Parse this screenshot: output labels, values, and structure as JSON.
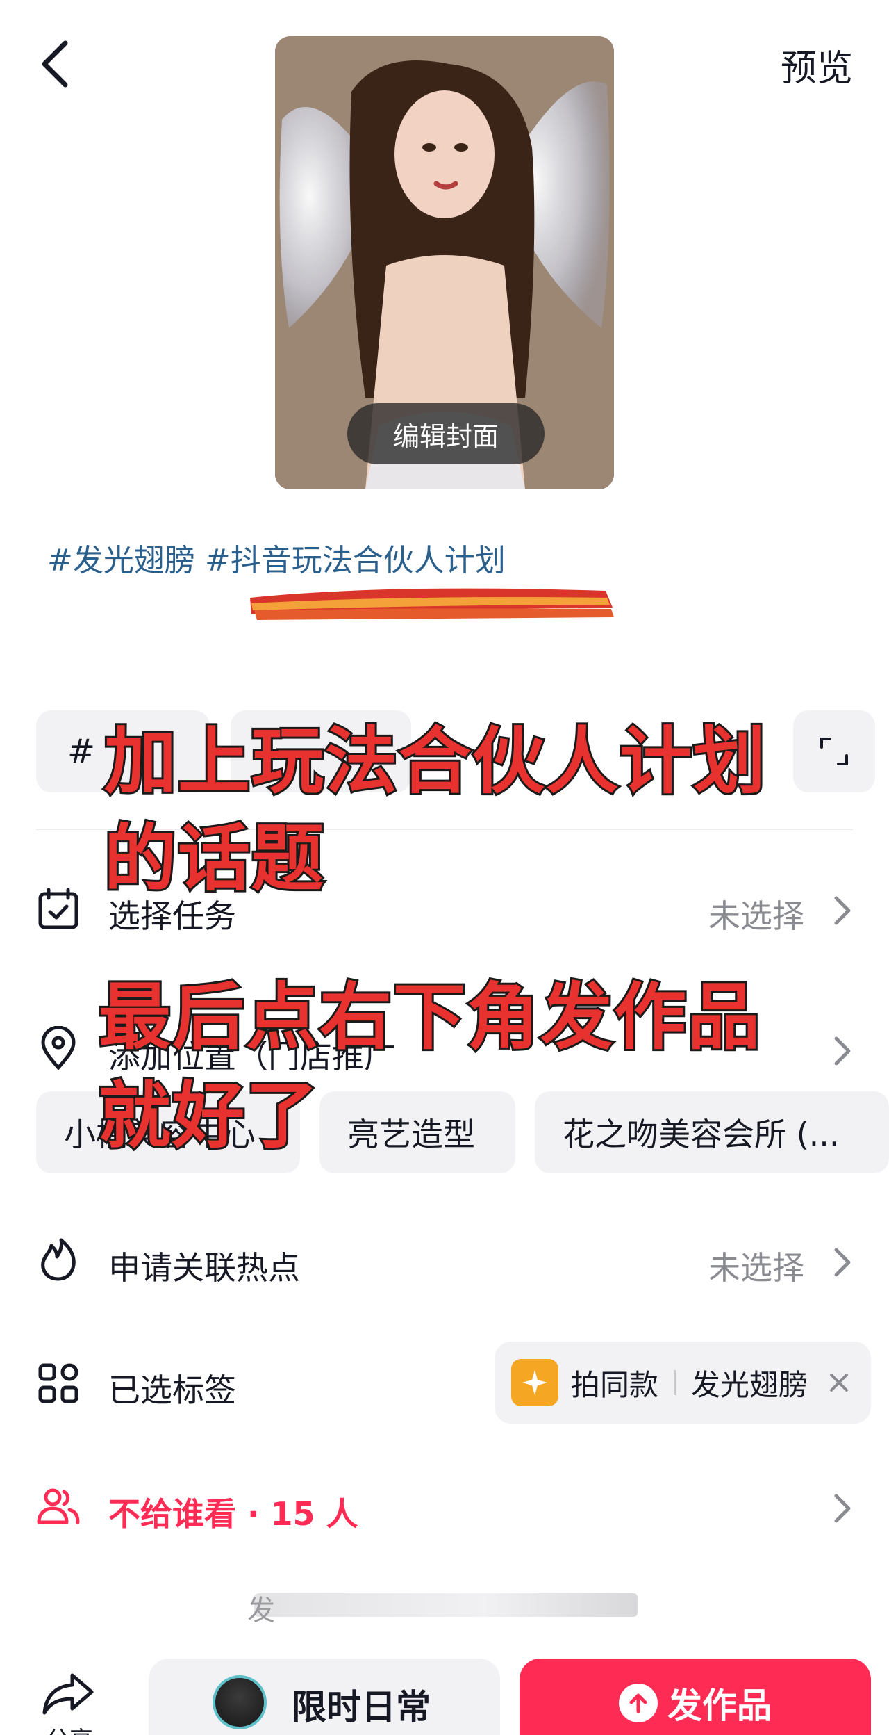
{
  "header": {
    "back_icon": "chevron-left-icon",
    "preview_label": "预览"
  },
  "cover": {
    "edit_label": "编辑封面"
  },
  "caption": {
    "topics": "#发光翅膀 #抖音玩法合伙人计划"
  },
  "chips": {
    "hash_symbol": "#",
    "scan_icon": "scan-icon"
  },
  "rows": {
    "task": {
      "label": "选择任务",
      "value": "未选择",
      "icon": "calendar-check-icon"
    },
    "location": {
      "label": "添加位置（门店推广",
      "icon": "location-pin-icon"
    },
    "location_suggestions": [
      "小楠美容中心",
      "亮艺造型",
      "花之吻美容会所 (..."
    ],
    "hotspot": {
      "label": "申请关联热点",
      "value": "未选择",
      "icon": "flame-icon"
    },
    "tags": {
      "label": "已选标签",
      "icon": "grid-icon",
      "tag_type": "拍同款",
      "tag_name": "发光翅膀"
    },
    "privacy": {
      "label": "不给谁看 · 15 人",
      "icon": "users-icon"
    }
  },
  "overlay": {
    "line1": "加上玩法合伙人计划",
    "line2": "的话题",
    "line3": "最后点右下角发作品",
    "line4": "就好了"
  },
  "progress": {
    "label": "发"
  },
  "bottom_bar": {
    "share_label": "分享",
    "daily_label": "限时日常",
    "publish_label": "发作品"
  },
  "colors": {
    "accent": "#fe2c55",
    "topic": "#2b5f8c",
    "overlay_text": "#e8322f"
  }
}
